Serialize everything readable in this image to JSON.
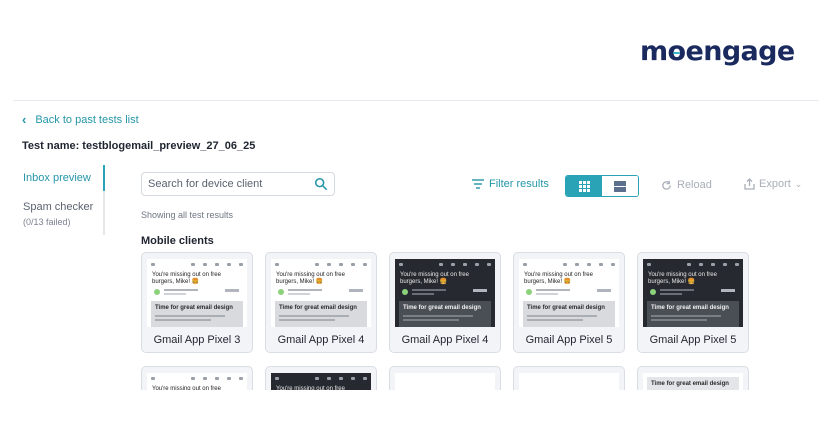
{
  "brand": {
    "logo_text": "moengage",
    "accent": "#39b6c8",
    "color": "#1b2a5e"
  },
  "nav": {
    "back_label": "Back to past tests list"
  },
  "test": {
    "name_label": "Test name: testblogemail_preview_27_06_25"
  },
  "sidebar": {
    "items": [
      {
        "label": "Inbox preview",
        "active": true
      },
      {
        "label": "Spam checker",
        "sub": "(0/13 failed)",
        "active": false
      }
    ]
  },
  "toolbar": {
    "search_placeholder": "Search for device client",
    "filter_label": "Filter results",
    "reload_label": "Reload",
    "export_label": "Export",
    "view_mode": "grid"
  },
  "results": {
    "status_text": "Showing all test results",
    "section_title": "Mobile clients",
    "preview_subject": "You're missing out on free burgers, Mike! 🍔",
    "preview_heading": "Time for great email design",
    "cards": [
      {
        "label": "Gmail App Pixel 3",
        "theme": "light"
      },
      {
        "label": "Gmail App Pixel 4",
        "theme": "light"
      },
      {
        "label": "Gmail App Pixel 4",
        "theme": "dark"
      },
      {
        "label": "Gmail App Pixel 5",
        "theme": "light"
      },
      {
        "label": "Gmail App Pixel 5",
        "theme": "dark"
      }
    ]
  },
  "colors": {
    "accent": "#2aa3b6",
    "link": "#2596a8",
    "muted": "#a9aeb8"
  }
}
